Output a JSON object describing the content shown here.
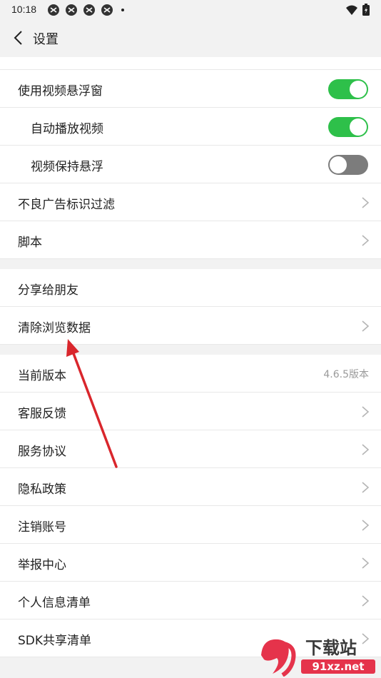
{
  "status_bar": {
    "time": "10:18"
  },
  "header": {
    "title": "设置"
  },
  "sections": [
    [
      {
        "label": "使用视频悬浮窗",
        "control": "toggle",
        "on": true,
        "sub": false
      },
      {
        "label": "自动播放视频",
        "control": "toggle",
        "on": true,
        "sub": true
      },
      {
        "label": "视频保持悬浮",
        "control": "toggle",
        "on": false,
        "sub": true
      },
      {
        "label": "不良广告标识过滤",
        "control": "chevron",
        "sub": false
      },
      {
        "label": "脚本",
        "control": "chevron",
        "sub": false
      }
    ],
    [
      {
        "label": "分享给朋友",
        "control": "none",
        "sub": false
      },
      {
        "label": "清除浏览数据",
        "control": "chevron",
        "sub": false
      }
    ],
    [
      {
        "label": "当前版本",
        "control": "value",
        "value": "4.6.5版本",
        "sub": false
      },
      {
        "label": "客服反馈",
        "control": "chevron",
        "sub": false
      },
      {
        "label": "服务协议",
        "control": "chevron",
        "sub": false
      },
      {
        "label": "隐私政策",
        "control": "chevron",
        "sub": false
      },
      {
        "label": "注销账号",
        "control": "chevron",
        "sub": false
      },
      {
        "label": "举报中心",
        "control": "chevron",
        "sub": false
      },
      {
        "label": "个人信息清单",
        "control": "chevron",
        "sub": false
      },
      {
        "label": "SDK共享清单",
        "control": "chevron",
        "sub": false
      }
    ]
  ],
  "colors": {
    "toggle_on": "#2ec04a",
    "toggle_off": "#7c7c7c",
    "annotation_arrow": "#d9262c"
  },
  "watermark": {
    "brand": "下载站",
    "domain": "91xz.net"
  }
}
